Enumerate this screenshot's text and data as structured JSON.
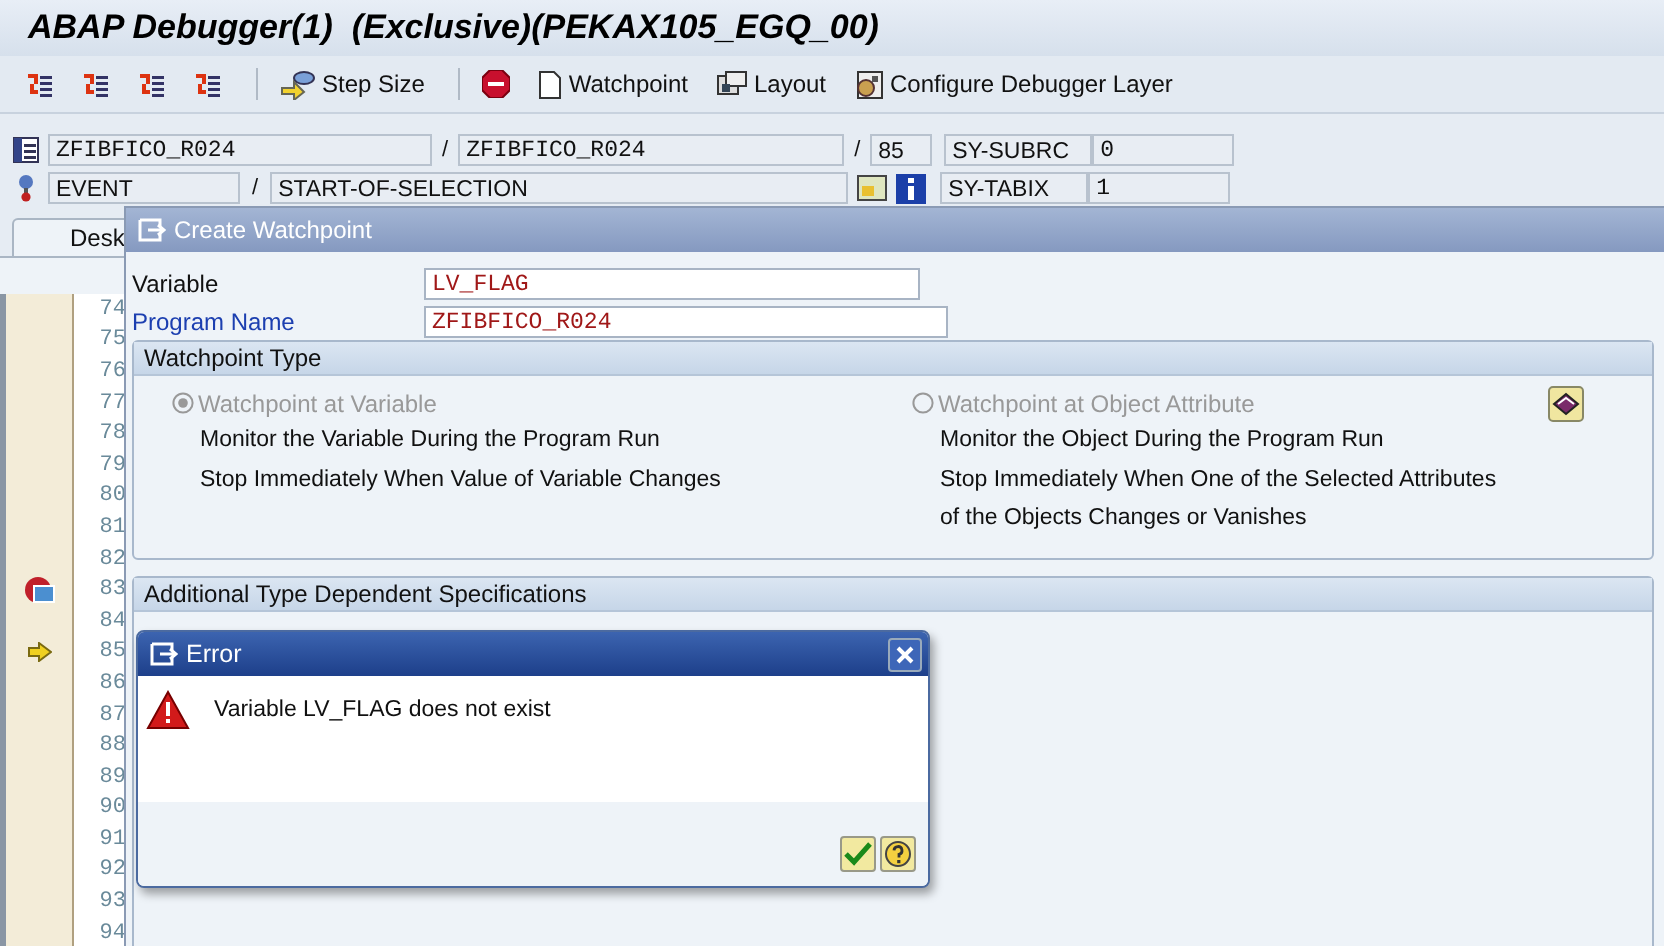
{
  "window": {
    "title": "ABAP Debugger(1)  (Exclusive)(PEKAX105_EGQ_00)"
  },
  "toolbar": [
    {
      "kind": "stepper"
    },
    {
      "kind": "stepper"
    },
    {
      "kind": "stepper"
    },
    {
      "kind": "stepper"
    },
    {
      "kind": "separator"
    },
    {
      "kind": "labeled",
      "label": "Step Size"
    },
    {
      "kind": "separator"
    },
    {
      "kind": "stop"
    },
    {
      "kind": "labeled",
      "label": "Watchpoint"
    },
    {
      "kind": "labeled",
      "label": "Layout"
    },
    {
      "kind": "labeled",
      "label": "Configure Debugger Layer"
    }
  ],
  "context": {
    "separators": [
      "/",
      "/",
      "/"
    ],
    "program": "ZFIBFICO_R024",
    "include": "ZFIBFICO_R024",
    "line": "85",
    "event_type": "EVENT",
    "event": "START-OF-SELECTION",
    "sy_fields": [
      {
        "name": "SY-SUBRC",
        "value": "0"
      },
      {
        "name": "SY-TABIX",
        "value": "1"
      }
    ]
  },
  "tabs": [
    {
      "label": "Desk",
      "selected": true
    }
  ],
  "lines": [
    {
      "number": "74",
      "kind": "plain"
    },
    {
      "number": "75",
      "kind": "plain"
    },
    {
      "number": "76",
      "kind": "plain"
    },
    {
      "number": "77",
      "kind": "plain"
    },
    {
      "number": "78",
      "kind": "plain"
    },
    {
      "number": "79",
      "kind": "plain"
    },
    {
      "number": "80",
      "kind": "plain"
    },
    {
      "number": "81",
      "kind": "plain"
    },
    {
      "number": "82",
      "kind": "plain"
    },
    {
      "number": "83",
      "kind": "breakpoint"
    },
    {
      "number": "84",
      "kind": "plain"
    },
    {
      "number": "85",
      "kind": "current"
    },
    {
      "number": "86",
      "kind": "plain"
    },
    {
      "number": "87",
      "kind": "plain"
    },
    {
      "number": "88",
      "kind": "plain"
    },
    {
      "number": "89",
      "kind": "plain"
    },
    {
      "number": "90",
      "kind": "plain"
    },
    {
      "number": "91",
      "kind": "plain"
    },
    {
      "number": "92",
      "kind": "plain"
    },
    {
      "number": "93",
      "kind": "plain"
    },
    {
      "number": "94",
      "kind": "plain"
    }
  ],
  "watchpoint_dialog": {
    "title": "Create Watchpoint",
    "fields": [
      {
        "label": "Variable",
        "value": "LV_FLAG",
        "emphasized": false
      },
      {
        "label": "Program Name",
        "value": "ZFIBFICO_R024",
        "emphasized": true
      }
    ],
    "type_group": {
      "title": "Watchpoint Type",
      "options": [
        {
          "label": "Watchpoint at Variable",
          "selected": true,
          "disabled": true,
          "lines": [
            "Monitor the Variable During the Program Run",
            "Stop Immediately When Value of Variable Changes"
          ]
        },
        {
          "label": "Watchpoint at Object Attribute",
          "selected": false,
          "disabled": true,
          "lines": [
            "Monitor the Object During the Program Run",
            "Stop Immediately When One of the Selected Attributes",
            "of the Objects Changes or Vanishes"
          ]
        }
      ]
    },
    "spec_group": {
      "title": "Additional Type Dependent Specifications"
    }
  },
  "error_dialog": {
    "title": "Error",
    "message": "Variable LV_FLAG does not exist"
  }
}
